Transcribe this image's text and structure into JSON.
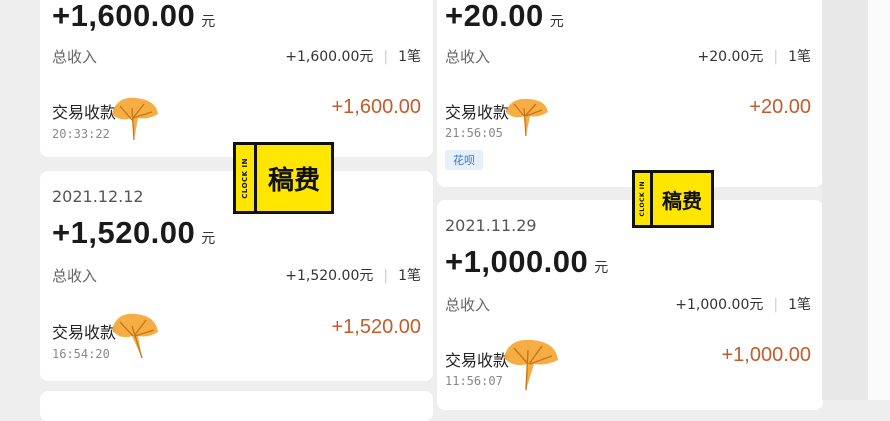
{
  "left": {
    "card1": {
      "amount": "+1,600.00",
      "unit": "元",
      "total_label": "总收入",
      "total_amount": "+1,600.00元",
      "count": "1笔",
      "tx_name": "交易收款",
      "tx_time": "20:33:22",
      "tx_amount": "+1,600.00"
    },
    "card2": {
      "date": "2021.12.12",
      "amount": "+1,520.00",
      "unit": "元",
      "total_label": "总收入",
      "total_amount": "+1,520.00元",
      "count": "1笔",
      "tx_name": "交易收款",
      "tx_time": "16:54:20",
      "tx_amount": "+1,520.00"
    }
  },
  "right": {
    "card1": {
      "amount": "+20.00",
      "unit": "元",
      "total_label": "总收入",
      "total_amount": "+20.00元",
      "count": "1笔",
      "tx_name": "交易收款",
      "tx_time": "21:56:05",
      "tx_amount": "+20.00",
      "tag": "花呗"
    },
    "card2": {
      "date": "2021.11.29",
      "amount": "+1,000.00",
      "unit": "元",
      "total_label": "总收入",
      "total_amount": "+1,000.00元",
      "count": "1笔",
      "tx_name": "交易收款",
      "tx_time": "11:56:07",
      "tx_amount": "+1,000.00"
    }
  },
  "stickers": [
    {
      "side_text": "CLOCK IN",
      "main_text": "稿费"
    },
    {
      "side_text": "CLOCK IN",
      "main_text": "稿费"
    }
  ],
  "colors": {
    "income_orange": "#c65b2a",
    "sticker_yellow": "#ffe600",
    "tag_blue": "#3a74c2",
    "leaf_orange": "#f4a93a"
  }
}
